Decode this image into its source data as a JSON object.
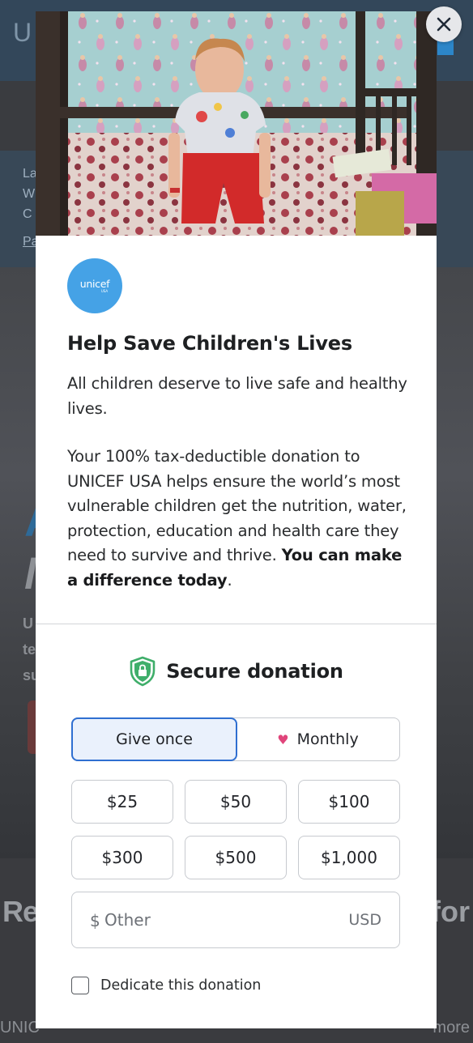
{
  "background_page": {
    "logo_fragment": "U",
    "strip_fragments": [
      "La",
      "W",
      "C",
      "Pa"
    ],
    "hero_fragments": [
      "A",
      "M"
    ],
    "side_fragments": [
      "U",
      "te",
      "su"
    ],
    "section_left": "Rel",
    "section_right": "for",
    "footer_left": "UNIC",
    "footer_right": "more"
  },
  "modal": {
    "close_icon": "close-icon",
    "logo": {
      "text": "unicef",
      "sub": "USA"
    },
    "title": "Help Save Children's Lives",
    "intro": "All children deserve to live safe and healthy lives.",
    "body_start": "Your 100% tax-deductible donation to UNICEF USA helps ensure the world’s most vulnerable children get the nutrition, water, protection, education and health care they need to survive and thrive. ",
    "body_bold": "You can make a difference today",
    "body_end": ".",
    "secure_label": "Secure donation",
    "frequency": {
      "give_once": "Give once",
      "monthly": "Monthly",
      "selected": "Give once"
    },
    "amounts": [
      "$25",
      "$50",
      "$100",
      "$300",
      "$500",
      "$1,000"
    ],
    "other": {
      "currency_symbol": "$",
      "placeholder": "Other",
      "currency_code": "USD"
    },
    "dedicate_label": "Dedicate this donation"
  },
  "colors": {
    "accent_blue": "#2f6fd1",
    "unicef_blue": "#45a2e6",
    "heart_pink": "#e0457b",
    "shield_green": "#3fae6a"
  }
}
